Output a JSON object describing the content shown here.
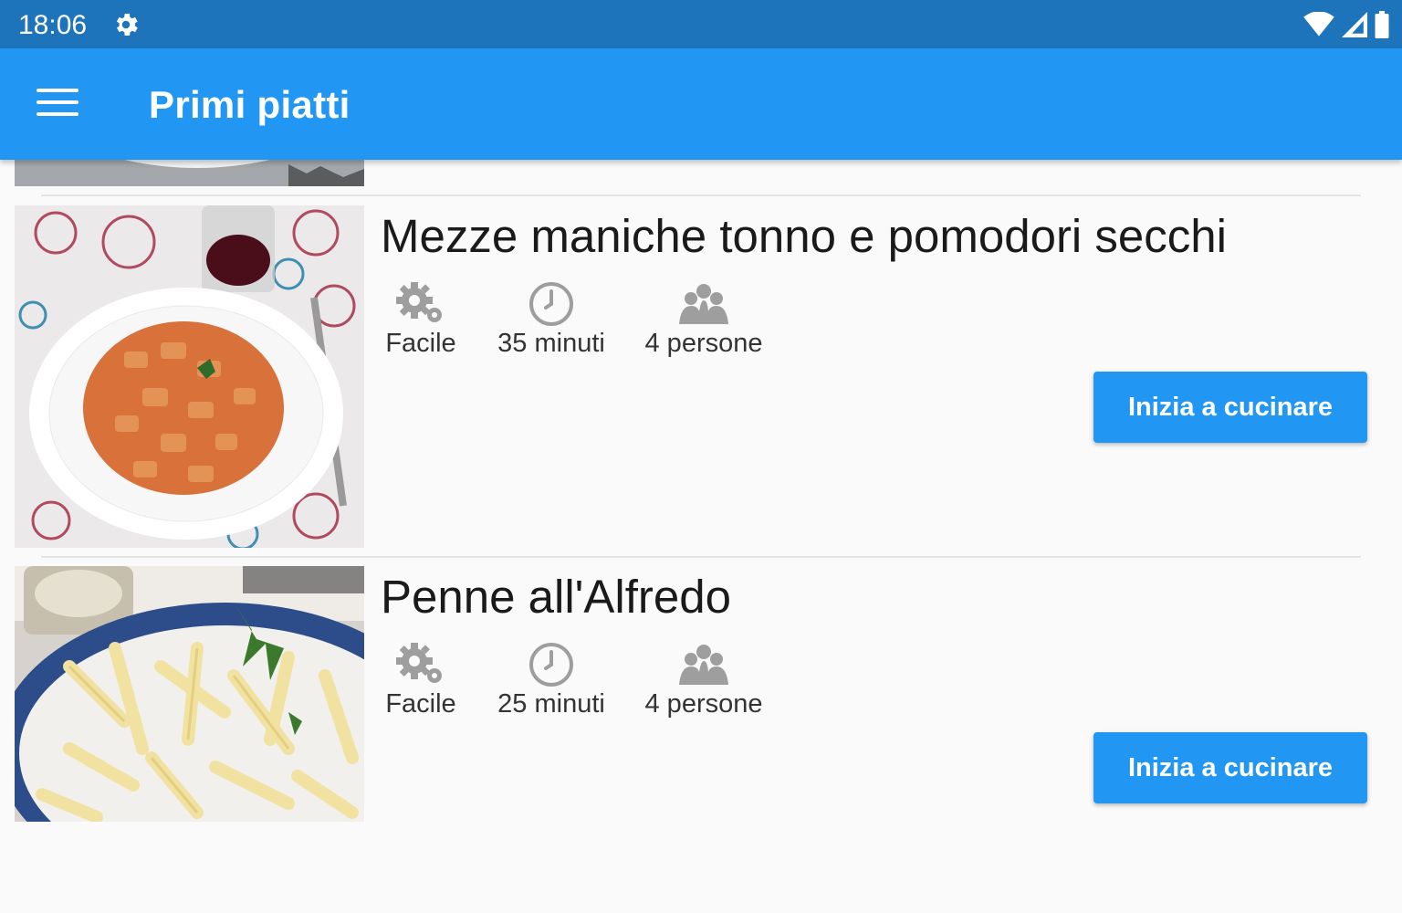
{
  "status_bar": {
    "time": "18:06"
  },
  "app_bar": {
    "title": "Primi piatti"
  },
  "recipes": [
    {
      "title": "Mezze maniche tonno e pomodori secchi",
      "difficulty": "Facile",
      "time": "35 minuti",
      "servings": "4 persone",
      "button_label": "Inizia a cucinare"
    },
    {
      "title": "Penne all'Alfredo",
      "difficulty": "Facile",
      "time": "25 minuti",
      "servings": "4 persone",
      "button_label": "Inizia a cucinare"
    }
  ],
  "colors": {
    "status_bar": "#1e74bb",
    "app_bar": "#2196f3",
    "accent": "#2196f3",
    "meta_icon": "#9e9e9e"
  }
}
